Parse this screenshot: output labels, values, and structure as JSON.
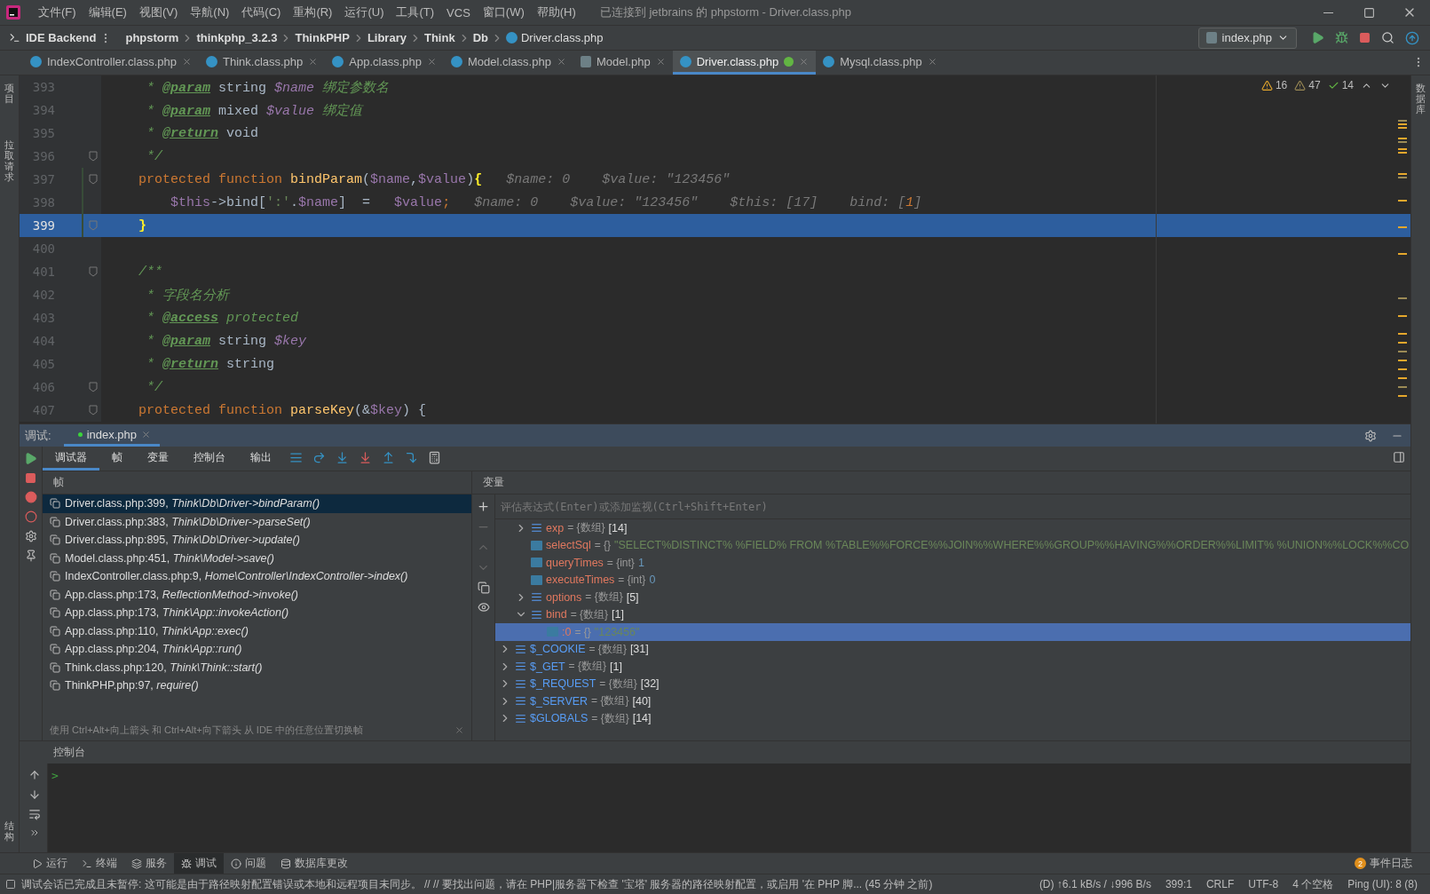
{
  "menu": [
    "文件(F)",
    "编辑(E)",
    "视图(V)",
    "导航(N)",
    "代码(C)",
    "重构(R)",
    "运行(U)",
    "工具(T)",
    "VCS",
    "窗口(W)",
    "帮助(H)"
  ],
  "window_title": "已连接到 jetbrains 的 phpstorm - Driver.class.php",
  "project_button": "IDE Backend",
  "breadcrumbs": [
    "phpstorm",
    "thinkphp_3.2.3",
    "ThinkPHP",
    "Library",
    "Think",
    "Db",
    "Driver.class.php"
  ],
  "run_config": "index.php",
  "editor_tabs": [
    {
      "label": "IndexController.class.php",
      "kind": "class",
      "selected": false,
      "badge": false
    },
    {
      "label": "Think.class.php",
      "kind": "class",
      "selected": false,
      "badge": false
    },
    {
      "label": "App.class.php",
      "kind": "class",
      "selected": false,
      "badge": false
    },
    {
      "label": "Model.class.php",
      "kind": "class",
      "selected": false,
      "badge": false
    },
    {
      "label": "Model.php",
      "kind": "php",
      "selected": false,
      "badge": false
    },
    {
      "label": "Driver.class.php",
      "kind": "class",
      "selected": true,
      "badge": true
    },
    {
      "label": "Mysql.class.php",
      "kind": "class",
      "selected": false,
      "badge": false
    }
  ],
  "inspections": [
    {
      "kind": "warning",
      "count": "16"
    },
    {
      "kind": "weak",
      "count": "47"
    },
    {
      "kind": "ok",
      "count": "14"
    }
  ],
  "code_lines": [
    {
      "number": "393",
      "current": false,
      "fold": false,
      "changed": false,
      "tokens": [
        {
          "kind": "comment",
          "text": "     * "
        },
        {
          "kind": "tag",
          "text": "@param"
        },
        {
          "kind": "plain",
          "text": " string "
        },
        {
          "kind": "docvar",
          "text": "$name"
        },
        {
          "kind": "comment",
          "text": " 绑定参数名"
        }
      ]
    },
    {
      "number": "394",
      "current": false,
      "fold": false,
      "changed": false,
      "tokens": [
        {
          "kind": "comment",
          "text": "     * "
        },
        {
          "kind": "tag",
          "text": "@param"
        },
        {
          "kind": "plain",
          "text": " mixed "
        },
        {
          "kind": "docvar",
          "text": "$value"
        },
        {
          "kind": "comment",
          "text": " 绑定值"
        }
      ]
    },
    {
      "number": "395",
      "current": false,
      "fold": false,
      "changed": false,
      "tokens": [
        {
          "kind": "comment",
          "text": "     * "
        },
        {
          "kind": "tag",
          "text": "@return"
        },
        {
          "kind": "plain",
          "text": " void"
        }
      ]
    },
    {
      "number": "396",
      "current": false,
      "fold": true,
      "changed": false,
      "tokens": [
        {
          "kind": "comment",
          "text": "     */"
        }
      ]
    },
    {
      "number": "397",
      "current": false,
      "fold": true,
      "changed": true,
      "tokens": [
        {
          "kind": "keyword",
          "text": "    protected function "
        },
        {
          "kind": "func",
          "text": "bindParam"
        },
        {
          "kind": "plain",
          "text": "("
        },
        {
          "kind": "var",
          "text": "$name"
        },
        {
          "kind": "plain",
          "text": ","
        },
        {
          "kind": "var",
          "text": "$value"
        },
        {
          "kind": "plain",
          "text": ")"
        },
        {
          "kind": "bracket",
          "text": "{"
        },
        {
          "kind": "hint",
          "text": "   $name: 0    $value: \"123456\""
        }
      ]
    },
    {
      "number": "398",
      "current": false,
      "fold": false,
      "changed": true,
      "tokens": [
        {
          "kind": "var",
          "text": "        $this"
        },
        {
          "kind": "plain",
          "text": "->bind["
        },
        {
          "kind": "string",
          "text": "':'"
        },
        {
          "kind": "plain",
          "text": "."
        },
        {
          "kind": "var",
          "text": "$name"
        },
        {
          "kind": "plain",
          "text": "]  =   "
        },
        {
          "kind": "var",
          "text": "$value"
        },
        {
          "kind": "keyword",
          "text": ";"
        },
        {
          "kind": "hint",
          "text": "   $name: 0    $value: \"123456\"    $this: [17]    bind: ["
        },
        {
          "kind": "hintnum",
          "text": "1"
        },
        {
          "kind": "hint",
          "text": "]"
        }
      ]
    },
    {
      "number": "399",
      "current": true,
      "fold": true,
      "changed": true,
      "tokens": [
        {
          "kind": "bracket",
          "text": "    }"
        }
      ]
    },
    {
      "number": "400",
      "current": false,
      "fold": false,
      "changed": false
    },
    {
      "number": "401",
      "current": false,
      "fold": true,
      "changed": false,
      "tokens": [
        {
          "kind": "comment",
          "text": "    /**"
        }
      ]
    },
    {
      "number": "402",
      "current": false,
      "fold": false,
      "changed": false,
      "tokens": [
        {
          "kind": "comment",
          "text": "     * 字段名分析"
        }
      ]
    },
    {
      "number": "403",
      "current": false,
      "fold": false,
      "changed": false,
      "tokens": [
        {
          "kind": "comment",
          "text": "     * "
        },
        {
          "kind": "tag",
          "text": "@access"
        },
        {
          "kind": "comment",
          "text": " protected"
        }
      ]
    },
    {
      "number": "404",
      "current": false,
      "fold": false,
      "changed": false,
      "tokens": [
        {
          "kind": "comment",
          "text": "     * "
        },
        {
          "kind": "tag",
          "text": "@param"
        },
        {
          "kind": "plain",
          "text": " string "
        },
        {
          "kind": "docvar",
          "text": "$key"
        }
      ]
    },
    {
      "number": "405",
      "current": false,
      "fold": false,
      "changed": false,
      "tokens": [
        {
          "kind": "comment",
          "text": "     * "
        },
        {
          "kind": "tag",
          "text": "@return"
        },
        {
          "kind": "plain",
          "text": " string"
        }
      ]
    },
    {
      "number": "406",
      "current": false,
      "fold": true,
      "changed": false,
      "tokens": [
        {
          "kind": "comment",
          "text": "     */"
        }
      ]
    },
    {
      "number": "407",
      "current": false,
      "fold": true,
      "changed": false,
      "tokens": [
        {
          "kind": "keyword",
          "text": "    protected function "
        },
        {
          "kind": "func",
          "text": "parseKey"
        },
        {
          "kind": "plain",
          "text": "(&"
        },
        {
          "kind": "var",
          "text": "$key"
        },
        {
          "kind": "plain",
          "text": ") {"
        }
      ]
    }
  ],
  "debug": {
    "label": "调试:",
    "session_tab": "index.php",
    "tabs": [
      {
        "label": "调试器",
        "selected": true
      },
      {
        "label": "帧",
        "selected": false
      },
      {
        "label": "变量",
        "selected": false
      },
      {
        "label": "控制台",
        "selected": false
      },
      {
        "label": "输出",
        "selected": false
      }
    ],
    "frames_header": "帧",
    "frames": [
      {
        "location": "Driver.class.php:399,",
        "method": "Think\\Db\\Driver->bindParam()",
        "selected": true
      },
      {
        "location": "Driver.class.php:383,",
        "method": "Think\\Db\\Driver->parseSet()",
        "selected": false
      },
      {
        "location": "Driver.class.php:895,",
        "method": "Think\\Db\\Driver->update()",
        "selected": false
      },
      {
        "location": "Model.class.php:451,",
        "method": "Think\\Model->save()",
        "selected": false
      },
      {
        "location": "IndexController.class.php:9,",
        "method": "Home\\Controller\\IndexController->index()",
        "selected": false
      },
      {
        "location": "App.class.php:173,",
        "method": "ReflectionMethod->invoke()",
        "selected": false
      },
      {
        "location": "App.class.php:173,",
        "method": "Think\\App::invokeAction()",
        "selected": false
      },
      {
        "location": "App.class.php:110,",
        "method": "Think\\App::exec()",
        "selected": false
      },
      {
        "location": "App.class.php:204,",
        "method": "Think\\App::run()",
        "selected": false
      },
      {
        "location": "Think.class.php:120,",
        "method": "Think\\Think::start()",
        "selected": false
      },
      {
        "location": "ThinkPHP.php:97,",
        "method": "require()",
        "selected": false
      }
    ],
    "frames_hint": "使用 Ctrl+Alt+向上箭头 和 Ctrl+Alt+向下箭头 从 IDE 中的任意位置切换帧",
    "variables_header": "变量",
    "eval_placeholder": "评估表达式(Enter)或添加监视(Ctrl+Shift+Enter)",
    "variables_continued": [
      {
        "name": "exp",
        "type": "= {数组}",
        "value": "[14]",
        "kind": "array",
        "expanded": false,
        "selected": false
      },
      {
        "name": "selectSql",
        "type": "= {}",
        "value": "\"SELECT%DISTINCT% %FIELD% FROM %TABLE%%FORCE%%JOIN%%WHERE%%GROUP%%HAVING%%ORDER%%LIMIT% %UNION%%LOCK%%CO",
        "kind": "string",
        "selected": false
      },
      {
        "name": "queryTimes",
        "type": "= {int}",
        "value": "1",
        "kind": "int",
        "selected": false
      },
      {
        "name": "executeTimes",
        "type": "= {int}",
        "value": "0",
        "kind": "int",
        "selected": false
      },
      {
        "name": "options",
        "type": "= {数组}",
        "value": "[5]",
        "kind": "array",
        "expanded": false,
        "selected": false
      },
      {
        "name": "bind",
        "type": "= {数组}",
        "value": "[1]",
        "kind": "array",
        "expanded": true,
        "selected": false,
        "children": [
          {
            "name": ":0",
            "type": "= {}",
            "value": "\"123456\"",
            "kind": "string",
            "selected": true
          }
        ]
      }
    ],
    "variables": [
      {
        "name": "$_COOKIE",
        "type": "= {数组}",
        "value": "[31]",
        "kind": "array",
        "expanded": false,
        "selected": false
      },
      {
        "name": "$_GET",
        "type": "= {数组}",
        "value": "[1]",
        "kind": "array",
        "expanded": false,
        "selected": false
      },
      {
        "name": "$_REQUEST",
        "type": "= {数组}",
        "value": "[32]",
        "kind": "array",
        "expanded": false,
        "selected": false
      },
      {
        "name": "$_SERVER",
        "type": "= {数组}",
        "value": "[40]",
        "kind": "array",
        "expanded": false,
        "selected": false
      },
      {
        "name": "$GLOBALS",
        "type": "= {数组}",
        "value": "[14]",
        "kind": "array",
        "expanded": false,
        "selected": false
      }
    ]
  },
  "console_header": "控制台",
  "console_prompt": ">",
  "tool_windows": [
    {
      "label": "运行",
      "selected": false
    },
    {
      "label": "终端",
      "selected": false
    },
    {
      "label": "服务",
      "selected": false
    },
    {
      "label": "调试",
      "selected": true
    },
    {
      "label": "问题",
      "selected": false
    },
    {
      "label": "数据库更改",
      "selected": false
    }
  ],
  "event_log": {
    "count": "2",
    "label": "事件日志"
  },
  "status": {
    "message": "调试会话已完成且未暂停: 这可能是由于路径映射配置错误或本地和远程项目未同步。 // // 要找出问题，请在 PHP|服务器下检查 '宝塔' 服务器的路径映射配置，或启用 '在 PHP 脚... (45 分钟 之前)",
    "items": [
      "(D) ↑6.1 kB/s / ↓996 B/s",
      "399:1",
      "CRLF",
      "UTF-8",
      "4 个空格",
      "Ping (UI): 8 (8)"
    ]
  },
  "side_left": [
    "项目",
    "拉取请求",
    "结构"
  ],
  "side_right": [
    "数据库"
  ]
}
